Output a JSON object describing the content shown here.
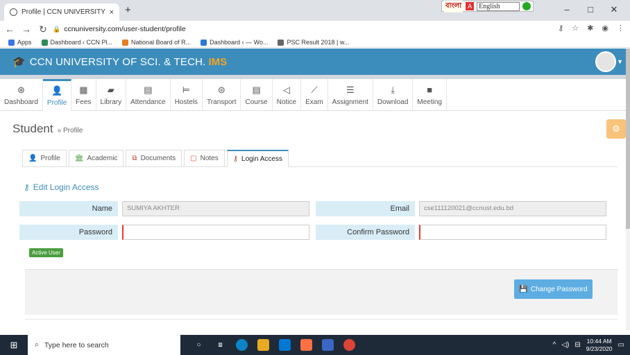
{
  "browser": {
    "tab_title": "Profile | CCN UNIVERSITY OF SCI",
    "tab_close": "×",
    "new_tab": "+",
    "url": "ccnuniversity.com/user-student/profile",
    "ext_bangla": "বাংলা",
    "ext_lang": "English",
    "win_min": "–",
    "win_max": "□",
    "win_close": "✕",
    "bookmarks": [
      {
        "label": "Apps",
        "color": "#3b78e7"
      },
      {
        "label": "Dashboard ‹ CCN Pl...",
        "color": "#2e8b57"
      },
      {
        "label": "National Board of R...",
        "color": "#e67e22"
      },
      {
        "label": "Dashboard ‹ — Wo...",
        "color": "#2c7ad6"
      },
      {
        "label": "PSC Result 2018 | w...",
        "color": "#666666"
      }
    ]
  },
  "app": {
    "brand": "CCN UNIVERSITY OF SCI. & TECH.",
    "brand_suffix": "IMS",
    "accent": "#3c8dbc"
  },
  "modules": [
    {
      "label": "Dashboard",
      "icon": "dashboard-icon",
      "glyph": "⊛",
      "active": false
    },
    {
      "label": "Profile",
      "icon": "user-icon",
      "glyph": "👤",
      "active": true
    },
    {
      "label": "Fees",
      "icon": "calculator-icon",
      "glyph": "▦",
      "active": false
    },
    {
      "label": "Library",
      "icon": "book-icon",
      "glyph": "▰",
      "active": false
    },
    {
      "label": "Attendance",
      "icon": "calendar-icon",
      "glyph": "▤",
      "active": false
    },
    {
      "label": "Hostels",
      "icon": "bed-icon",
      "glyph": "⊨",
      "active": false
    },
    {
      "label": "Transport",
      "icon": "bus-icon",
      "glyph": "⊜",
      "active": false
    },
    {
      "label": "Course",
      "icon": "list-icon",
      "glyph": "▤",
      "active": false
    },
    {
      "label": "Notice",
      "icon": "bullhorn-icon",
      "glyph": "◁",
      "active": false
    },
    {
      "label": "Exam",
      "icon": "chart-icon",
      "glyph": "⟋",
      "active": false
    },
    {
      "label": "Assignment",
      "icon": "tasks-icon",
      "glyph": "☰",
      "active": false
    },
    {
      "label": "Download",
      "icon": "download-icon",
      "glyph": "⤓",
      "active": false
    },
    {
      "label": "Meeting",
      "icon": "video-icon",
      "glyph": "■",
      "active": false
    }
  ],
  "page": {
    "title": "Student",
    "breadcrumb": "» Profile"
  },
  "subtabs": [
    {
      "label": "Profile",
      "icon": "user-icon",
      "glyph": "👤",
      "color": "#4a9e3f",
      "active": false
    },
    {
      "label": "Academic",
      "icon": "institution-icon",
      "glyph": "🏛",
      "color": "#4a9e3f",
      "active": false
    },
    {
      "label": "Documents",
      "icon": "copy-icon",
      "glyph": "⧉",
      "color": "#c0392b",
      "active": false
    },
    {
      "label": "Notes",
      "icon": "note-icon",
      "glyph": "▢",
      "color": "#e74c3c",
      "active": false
    },
    {
      "label": "Login Access",
      "icon": "key-icon",
      "glyph": "⚷",
      "color": "#c0392b",
      "active": true
    }
  ],
  "form": {
    "title": "Edit Login Access",
    "name_label": "Name",
    "name_value": "SUMIYA AKHTER",
    "email_label": "Email",
    "email_value": "cse111120021@ccnust.edu.bd",
    "password_label": "Password",
    "password_value": "",
    "confirm_label": "Confirm Password",
    "confirm_value": "",
    "status_badge": "Active User",
    "submit_label": "Change Password"
  },
  "taskbar": {
    "search_placeholder": "Type here to search",
    "time": "10:44 AM",
    "date": "9/23/2020"
  }
}
